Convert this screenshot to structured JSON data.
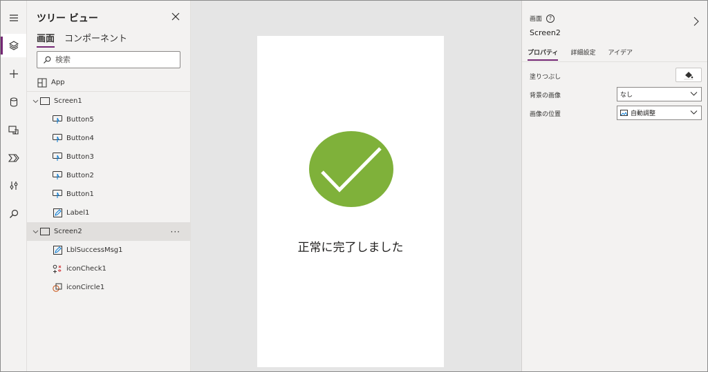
{
  "rail": {
    "items": [
      {
        "icon": "hamburger-menu-icon"
      },
      {
        "icon": "layers-icon",
        "active": true
      },
      {
        "icon": "plus-icon"
      },
      {
        "icon": "database-icon"
      },
      {
        "icon": "media-icon"
      },
      {
        "icon": "power-automate-icon"
      },
      {
        "icon": "advanced-tools-icon"
      },
      {
        "icon": "search-icon"
      }
    ]
  },
  "tree": {
    "title": "ツリー ビュー",
    "tabs": [
      "画面",
      "コンポーネント"
    ],
    "active_tab": "画面",
    "search_placeholder": "検索",
    "app_label": "App",
    "screen1": {
      "label": "Screen1",
      "children": [
        "Button5",
        "Button4",
        "Button3",
        "Button2",
        "Button1",
        "Label1"
      ]
    },
    "screen2": {
      "label": "Screen2",
      "more": "···",
      "children": [
        "LblSuccessMsg1",
        "iconCheck1",
        "iconCircle1"
      ]
    }
  },
  "canvas": {
    "success_message": "正常に完了しました",
    "circle_color": "#7fb13a",
    "check_color": "#ffffff"
  },
  "properties": {
    "type_label": "画面",
    "help_icon": "?",
    "screen_name": "Screen2",
    "tabs": [
      "プロパティ",
      "詳細設定",
      "アイデア"
    ],
    "active_tab": "プロパティ",
    "fill_label": "塗りつぶし",
    "bg_image_label": "背景の画像",
    "bg_image_value": "なし",
    "image_position_label": "画像の位置",
    "image_position_value": "自動調整"
  },
  "theme": {
    "accent": "#742774"
  }
}
